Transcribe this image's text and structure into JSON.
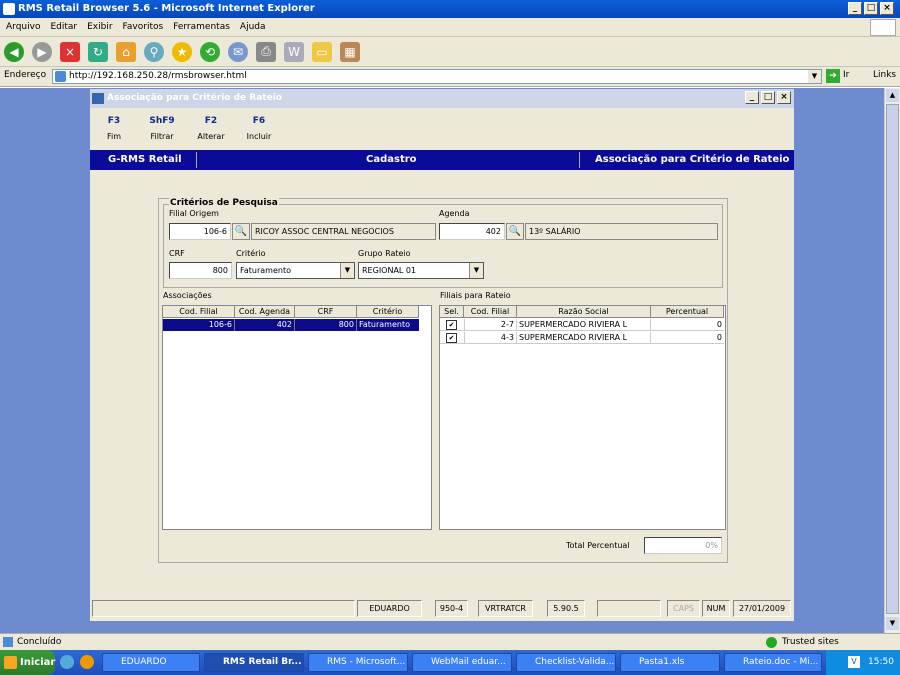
{
  "ie": {
    "title": "RMS Retail Browser 5.6 - Microsoft Internet Explorer",
    "menu": [
      "Arquivo",
      "Editar",
      "Exibir",
      "Favoritos",
      "Ferramentas",
      "Ajuda"
    ],
    "address_label": "Endereço",
    "address": "http://192.168.250.28/rmsbrowser.html",
    "go_label": "Ir",
    "links_label": "Links",
    "status_text": "Concluído",
    "zone_text": "Trusted sites"
  },
  "app": {
    "title": "Associação para Critério de Rateio",
    "fkeys": [
      {
        "key": "F3",
        "label": "Fim"
      },
      {
        "key": "ShF9",
        "label": "Filtrar"
      },
      {
        "key": "F2",
        "label": "Alterar"
      },
      {
        "key": "F6",
        "label": "Incluir"
      }
    ],
    "header": {
      "left": "G-RMS Retail",
      "center": "Cadastro",
      "right": "Associação para Critério de Rateio"
    }
  },
  "search": {
    "group_title": "Critérios de Pesquisa",
    "filial_label": "Filial Origem",
    "filial_value": "106-6",
    "filial_desc": "RICOY ASSOC CENTRAL NEGOCIOS",
    "agenda_label": "Agenda",
    "agenda_value": "402",
    "agenda_desc": "13º SALÁRIO",
    "crf_label": "CRF",
    "crf_value": "800",
    "criterio_label": "Critério",
    "criterio_value": "Faturamento",
    "grupo_label": "Grupo Rateio",
    "grupo_value": "REGIONAL 01"
  },
  "associacoes": {
    "label": "Associações",
    "columns": [
      "Cod. Filial",
      "Cod. Agenda",
      "CRF",
      "Critério"
    ],
    "rows": [
      [
        "106-6",
        "402",
        "800",
        "Faturamento"
      ]
    ]
  },
  "filiais": {
    "label": "Filiais para Rateio",
    "columns": [
      "Sel.",
      "Cod. Filial",
      "Razão Social",
      "Percentual"
    ],
    "rows": [
      [
        "✔",
        "2-7",
        "SUPERMERCADO RIVIERA L",
        "0"
      ],
      [
        "✔",
        "4-3",
        "SUPERMERCADO RIVIERA L",
        "0"
      ]
    ]
  },
  "total": {
    "label": "Total Percentual",
    "value": "0%"
  },
  "statusbar": [
    "EDUARDO",
    "950-4",
    "VRTRATCR",
    "5.90.5",
    "",
    "CAPS",
    "NUM",
    "27/01/2009"
  ],
  "taskbar": {
    "start": "Iniciar",
    "tasks": [
      "EDUARDO",
      "RMS Retail Br...",
      "RMS - Microsoft...",
      "WebMail eduar...",
      "Checklist-Valida...",
      "Pasta1.xls",
      "Rateio.doc - Mi..."
    ],
    "clock": "15:50"
  }
}
